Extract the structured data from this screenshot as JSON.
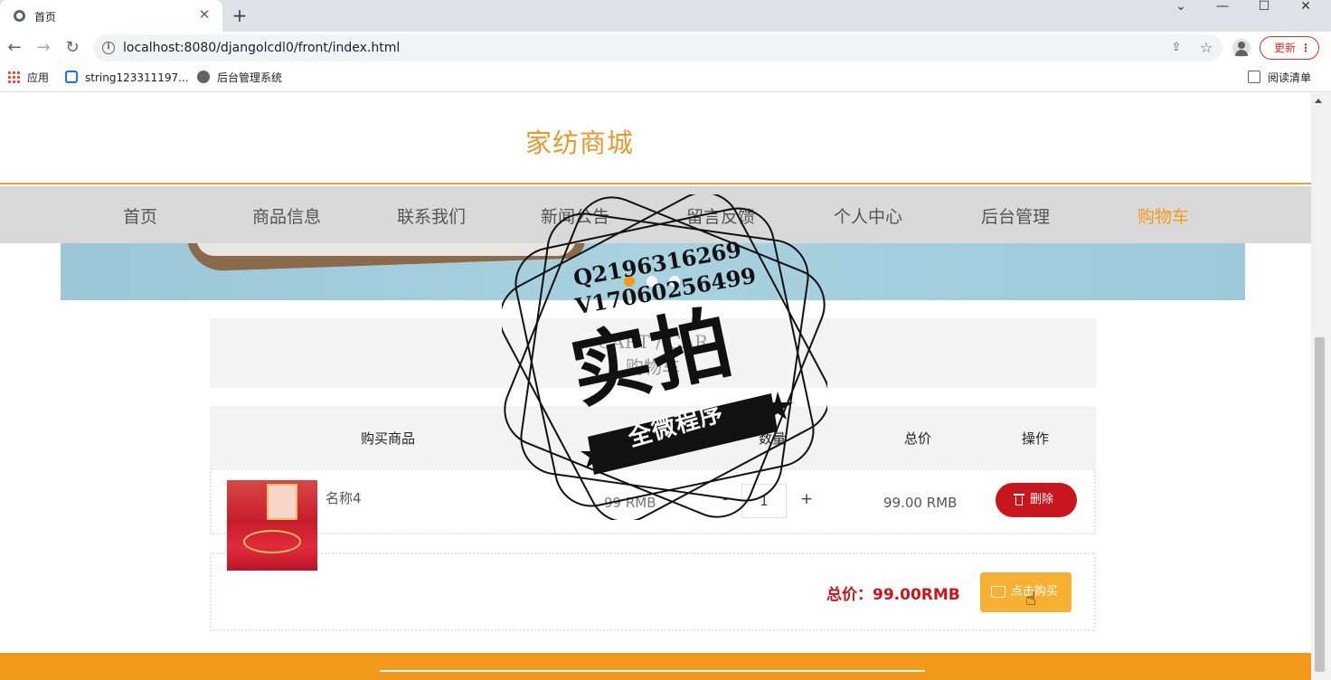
{
  "browser": {
    "tab_title": "首页",
    "url": "localhost:8080/djangolcdl0/front/index.html",
    "update_label": "更新",
    "bookmarks": [
      "应用",
      "string123311197...",
      "后台管理系统"
    ],
    "reading_list": "阅读清单"
  },
  "site": {
    "title": "家纺商城",
    "nav": [
      "首页",
      "商品信息",
      "联系我们",
      "新闻公告",
      "留言反馈",
      "个人中心",
      "后台管理",
      "购物车"
    ],
    "active_nav": "购物车"
  },
  "cart": {
    "heading_en": "CART / CAR",
    "heading_cn": "购物车",
    "columns": {
      "product": "购买商品",
      "quantity": "数量",
      "total": "总价",
      "action": "操作"
    },
    "items": [
      {
        "name": "名称4",
        "unit_price": "99 RMB",
        "quantity": "1",
        "total": "99.00 RMB",
        "delete_label": "删除"
      }
    ],
    "qty_minus": "-",
    "qty_plus": "+",
    "summary_label": "总价：99.00RMB",
    "buy_label": "点击购买"
  },
  "watermark": {
    "line1": "Q2196316269",
    "line2": "V17060256499",
    "big": "实拍",
    "ribbon": "全微程序"
  },
  "colors": {
    "accent": "#f39a1d",
    "delete": "#c8161d",
    "buy": "#f8b033"
  }
}
